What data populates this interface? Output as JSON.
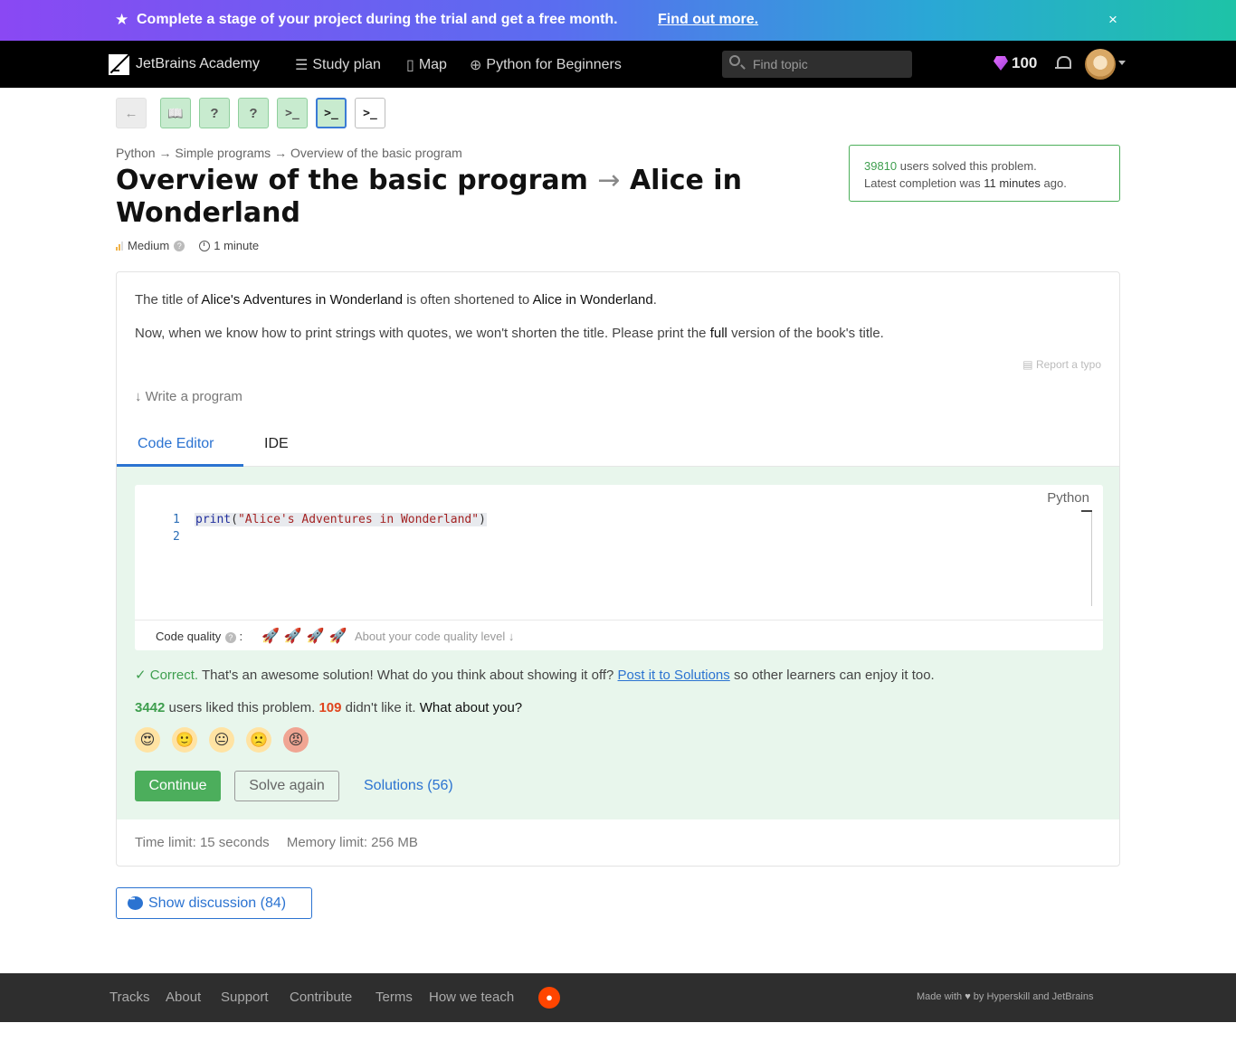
{
  "banner": {
    "text": "Complete a stage of your project during the trial and get a free month.",
    "link": "Find out more.",
    "close": "×"
  },
  "nav": {
    "brand": "JetBrains Academy",
    "items": [
      {
        "label": "Study plan",
        "icon": "list-icon"
      },
      {
        "label": "Map",
        "icon": "map-icon"
      },
      {
        "label": "Python for Beginners",
        "icon": "target-icon"
      }
    ],
    "search_placeholder": "Find topic",
    "gems": "100"
  },
  "steps": {
    "back": "←",
    "items": [
      {
        "glyph": "📖",
        "state": "done"
      },
      {
        "glyph": "?",
        "state": "done"
      },
      {
        "glyph": "?",
        "state": "done"
      },
      {
        "glyph": ">_",
        "state": "done"
      },
      {
        "glyph": ">_",
        "state": "current"
      },
      {
        "glyph": ">_",
        "state": "todo"
      }
    ]
  },
  "breadcrumb": "Python → Simple programs → Overview of the basic program",
  "title": {
    "part1": "Overview of the basic program",
    "arrow": "→",
    "part2": "Alice in Wonderland"
  },
  "meta": {
    "difficulty": "Medium",
    "duration": "1 minute"
  },
  "solved": {
    "count": "39810",
    "line1_rest": "users solved this problem.",
    "line2_a": "Latest completion was",
    "line2_b": "11 minutes",
    "line2_c": "ago."
  },
  "problem": {
    "p1_a": "The title of",
    "p1_b": "Alice's Adventures in Wonderland",
    "p1_c": "is often shortened to",
    "p1_d": "Alice in Wonderland",
    "p1_e": ".",
    "p2_a": "Now, when we know how to print strings with quotes, we won't shorten the title. Please print the",
    "p2_b": "full",
    "p2_c": "version of the book's title.",
    "report_typo": "Report a typo",
    "write_program": "Write a program"
  },
  "tabs": [
    "Code Editor",
    "IDE"
  ],
  "editor": {
    "language": "Python",
    "lines": [
      "1",
      "2"
    ],
    "code_kw": "print",
    "code_open": "(",
    "code_str": "\"Alice's Adventures in Wonderland\"",
    "code_close": ")",
    "quality_label": "Code quality",
    "quality_level": 4,
    "quality_about": "About your code quality level ↓"
  },
  "feedback": {
    "correct": "Correct.",
    "message": "That's an awesome solution! What do you think about showing it off?",
    "post_link": "Post it to Solutions",
    "message_end": "so other learners can enjoy it too.",
    "liked_count": "3442",
    "liked_text": "users liked this problem.",
    "disliked_count": "109",
    "disliked_text": "didn't like it.",
    "question": "What about you?",
    "emojis": [
      "😍",
      "🙂",
      "😐",
      "🙁",
      "😡"
    ]
  },
  "actions": {
    "continue": "Continue",
    "solve_again": "Solve again",
    "solutions": "Solutions (56)"
  },
  "limits": {
    "time": "Time limit: 15 seconds",
    "memory": "Memory limit: 256 MB"
  },
  "discussion": "Show discussion (84)",
  "footer": {
    "links": [
      "Tracks",
      "About",
      "Support",
      "Contribute",
      "Terms",
      "How we teach"
    ],
    "made_with_a": "Made with",
    "made_with_b": "by Hyperskill and JetBrains"
  }
}
